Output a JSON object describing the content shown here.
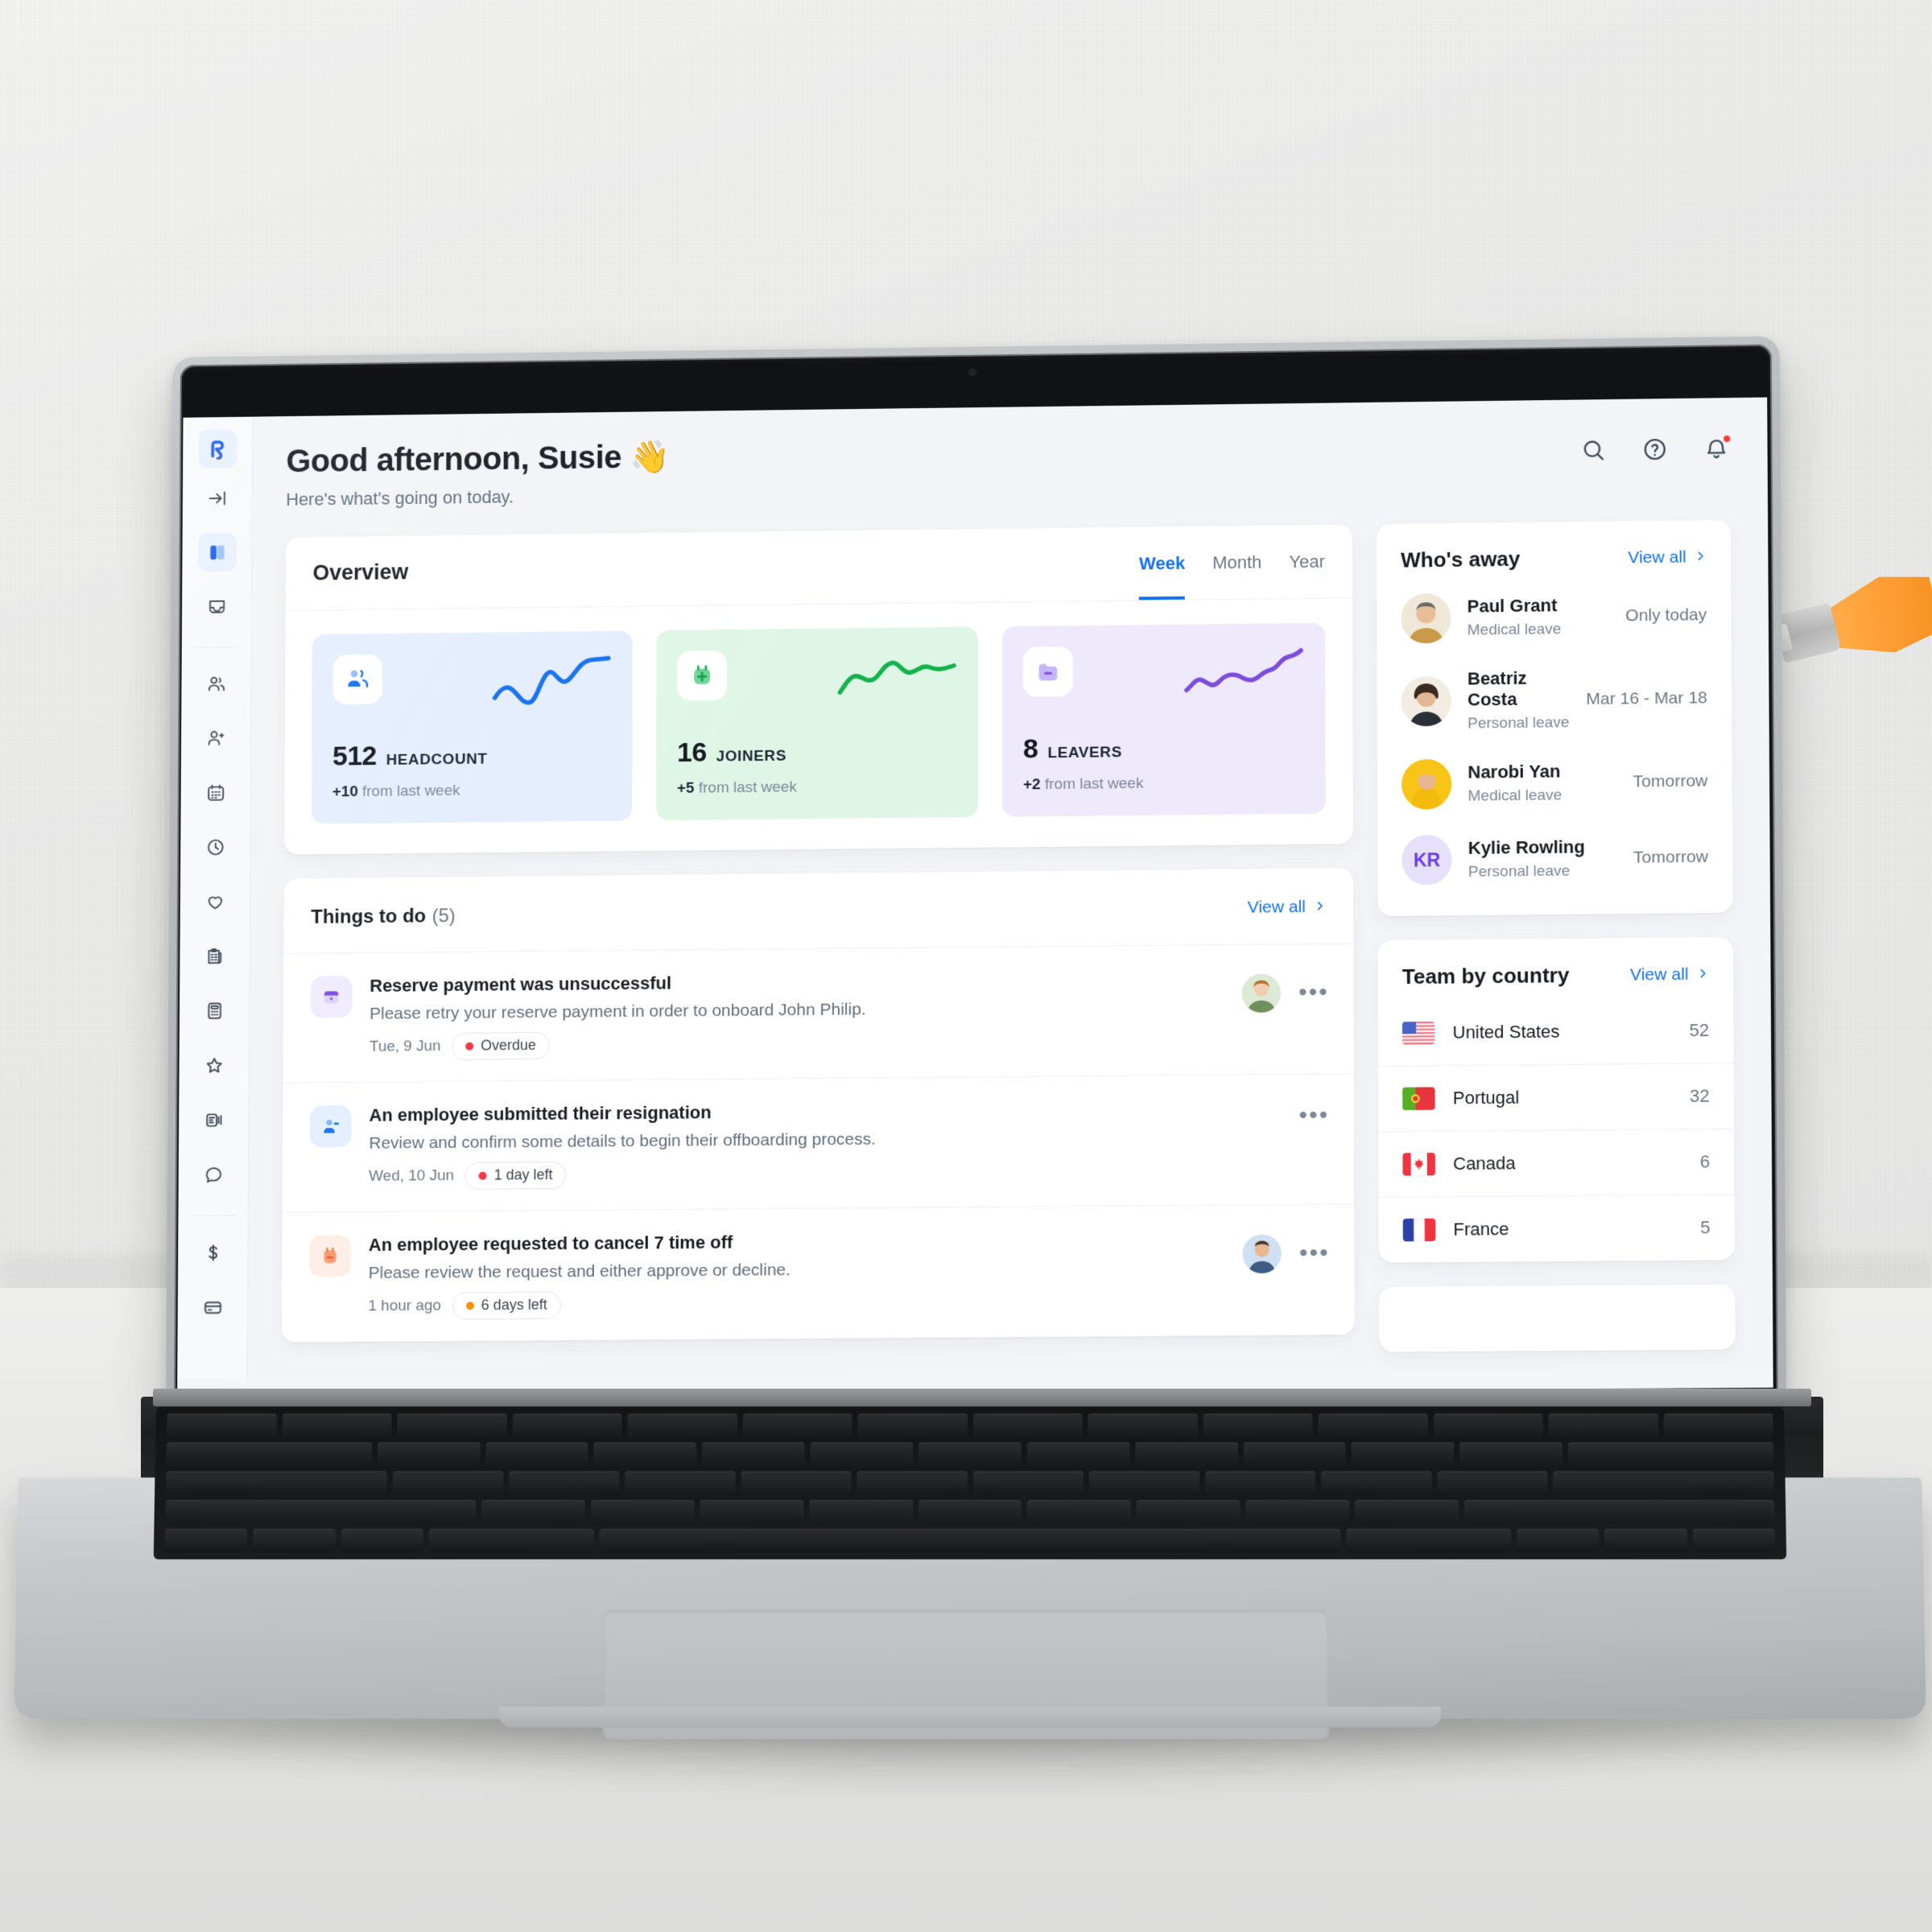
{
  "app": {
    "brand_icon": "rippling-r-logo",
    "accent_color": "#1570ef"
  },
  "sidebar": {
    "items": [
      {
        "icon": "rippling-r-logo",
        "name": "brand-logo",
        "active": false
      },
      {
        "icon": "collapse-arrow-icon",
        "name": "collapse-nav",
        "active": false
      },
      {
        "icon": "dashboard-panel-icon",
        "name": "dashboard",
        "active": true
      },
      {
        "icon": "inbox-icon",
        "name": "inbox",
        "active": false
      },
      {
        "icon": "people-icon",
        "name": "people",
        "active": false
      },
      {
        "icon": "add-person-icon",
        "name": "recruiting",
        "active": false
      },
      {
        "icon": "calendar-icon",
        "name": "calendar",
        "active": false
      },
      {
        "icon": "clock-icon",
        "name": "time-tracking",
        "active": false
      },
      {
        "icon": "heart-icon",
        "name": "benefits",
        "active": false
      },
      {
        "icon": "clipboard-icon",
        "name": "tasks",
        "active": false
      },
      {
        "icon": "calculator-icon",
        "name": "payroll",
        "active": false
      },
      {
        "icon": "star-icon",
        "name": "performance",
        "active": false
      },
      {
        "icon": "document-signal-icon",
        "name": "reports",
        "active": false
      },
      {
        "icon": "chat-bubble-icon",
        "name": "messages",
        "active": false
      },
      {
        "icon": "dollar-icon",
        "name": "expenses",
        "active": false
      },
      {
        "icon": "card-icon",
        "name": "cards",
        "active": false
      }
    ]
  },
  "header": {
    "greeting": "Good afternoon, Susie 👋",
    "subtitle": "Here's what's going on today.",
    "icons": [
      {
        "name": "search-icon",
        "label": "Search"
      },
      {
        "name": "help-icon",
        "label": "Help"
      },
      {
        "name": "notifications-bell-icon",
        "label": "Notifications",
        "has_badge": true
      }
    ]
  },
  "overview": {
    "title": "Overview",
    "tabs": [
      {
        "label": "Week",
        "active": true
      },
      {
        "label": "Month",
        "active": false
      },
      {
        "label": "Year",
        "active": false
      }
    ],
    "stats": [
      {
        "value": "512",
        "label": "HEADCOUNT",
        "delta": "+10",
        "delta_text": "from last week",
        "color": "#1570ef",
        "theme": "blue",
        "icon": "people-group-icon"
      },
      {
        "value": "16",
        "label": "JOINERS",
        "delta": "+5",
        "delta_text": "from last week",
        "color": "#12b24b",
        "theme": "green",
        "icon": "person-add-box-icon"
      },
      {
        "value": "8",
        "label": "LEAVERS",
        "delta": "+2",
        "delta_text": "from last week",
        "color": "#7c4ddb",
        "theme": "purple",
        "icon": "folder-minus-icon"
      }
    ]
  },
  "chart_data": [
    {
      "type": "line",
      "title": "Headcount trend",
      "series": [
        {
          "name": "Headcount",
          "values": [
            30,
            42,
            26,
            58,
            20,
            70,
            48,
            86,
            96
          ]
        }
      ],
      "x": [
        0,
        1,
        2,
        3,
        4,
        5,
        6,
        7,
        8
      ],
      "color": "#1570ef",
      "grid": false,
      "legend": "none",
      "xlabel": "",
      "ylabel": ""
    },
    {
      "type": "line",
      "title": "Joiners trend",
      "series": [
        {
          "name": "Joiners",
          "values": [
            26,
            52,
            46,
            62,
            86,
            66,
            74,
            62,
            78
          ]
        }
      ],
      "x": [
        0,
        1,
        2,
        3,
        4,
        5,
        6,
        7,
        8
      ],
      "color": "#12b24b",
      "grid": false,
      "legend": "none",
      "xlabel": "",
      "ylabel": ""
    },
    {
      "type": "line",
      "title": "Leavers trend",
      "series": [
        {
          "name": "Leavers",
          "values": [
            22,
            38,
            30,
            56,
            48,
            54,
            46,
            68,
            62,
            92
          ]
        }
      ],
      "x": [
        0,
        1,
        2,
        3,
        4,
        5,
        6,
        7,
        8,
        9
      ],
      "color": "#7c4ddb",
      "grid": false,
      "legend": "none",
      "xlabel": "",
      "ylabel": ""
    }
  ],
  "things_to_do": {
    "title": "Things to do",
    "count": "(5)",
    "view_all": "View all",
    "tasks": [
      {
        "title": "Reserve payment was unsuccessful",
        "description": "Please retry your reserve payment in order to onboard John Philip.",
        "date": "Tue, 9 Jun",
        "status": "Overdue",
        "status_color": "#f5333f",
        "icon": "payment-box-icon",
        "icon_theme": "purple",
        "has_avatar": true,
        "menu": "•••"
      },
      {
        "title": "An employee submitted their resignation",
        "description": "Review and confirm some details to begin their offboarding process.",
        "date": "Wed, 10 Jun",
        "status": "1 day left",
        "status_color": "#f5333f",
        "icon": "person-minus-icon",
        "icon_theme": "blue",
        "has_avatar": false,
        "menu": "•••"
      },
      {
        "title": "An employee requested to cancel 7 time off",
        "description": "Please review the request and either approve or decline.",
        "date": "1 hour ago",
        "status": "6 days left",
        "status_color": "#f79009",
        "icon": "time-off-box-icon",
        "icon_theme": "orange",
        "has_avatar": true,
        "menu": "•••"
      }
    ]
  },
  "whos_away": {
    "title": "Who's away",
    "view_all": "View all",
    "people": [
      {
        "name": "Paul Grant",
        "leave": "Medical leave",
        "when": "Only today",
        "avatar_type": "photo",
        "avatar_bg": "#efe7d8",
        "initials": "PG"
      },
      {
        "name": "Beatriz Costa",
        "leave": "Personal leave",
        "when": "Mar 16 - Mar 18",
        "avatar_type": "photo",
        "avatar_bg": "#f2ece2",
        "initials": "BC"
      },
      {
        "name": "Narobi Yan",
        "leave": "Medical leave",
        "when": "Tomorrow",
        "avatar_type": "photo",
        "avatar_bg": "#f7c417",
        "initials": "NY"
      },
      {
        "name": "Kylie Rowling",
        "leave": "Personal leave",
        "when": "Tomorrow",
        "avatar_type": "initials",
        "avatar_bg": "#e6e0fb",
        "initials": "KR"
      }
    ]
  },
  "team_by_country": {
    "title": "Team by country",
    "view_all": "View all",
    "countries": [
      {
        "name": "United States",
        "count": "52",
        "flag": "us-flag"
      },
      {
        "name": "Portugal",
        "count": "32",
        "flag": "pt-flag"
      },
      {
        "name": "Canada",
        "count": "6",
        "flag": "ca-flag"
      },
      {
        "name": "France",
        "count": "5",
        "flag": "fr-flag"
      }
    ]
  }
}
